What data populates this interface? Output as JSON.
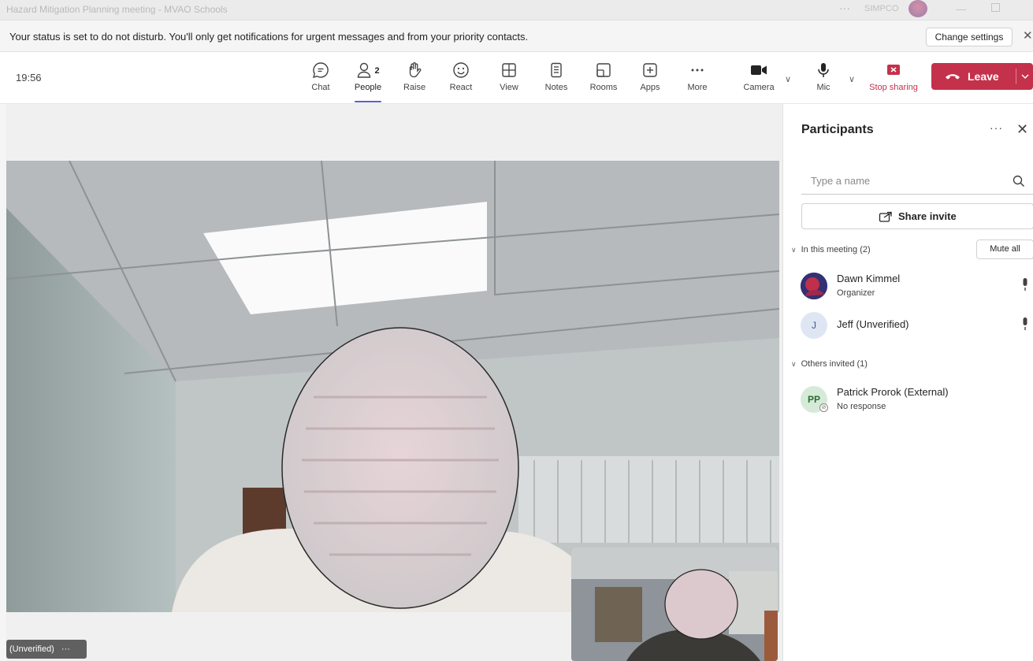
{
  "window": {
    "title": "Hazard Mitigation Planning meeting - MVAO Schools",
    "more": "···",
    "org": "SIMPCO"
  },
  "notification": {
    "message": "Your status is set to do not disturb. You'll only get notifications for urgent messages and from your priority contacts.",
    "change_settings": "Change settings"
  },
  "toolbar": {
    "time": "19:56",
    "people_count": "2",
    "buttons": [
      {
        "label": "Chat",
        "icon": "chat-icon"
      },
      {
        "label": "People",
        "icon": "people-icon"
      },
      {
        "label": "Raise",
        "icon": "hand-icon"
      },
      {
        "label": "React",
        "icon": "smiley-icon"
      },
      {
        "label": "View",
        "icon": "grid-icon"
      },
      {
        "label": "Notes",
        "icon": "notes-icon"
      },
      {
        "label": "Rooms",
        "icon": "rooms-icon"
      },
      {
        "label": "Apps",
        "icon": "apps-icon"
      },
      {
        "label": "More",
        "icon": "more-icon"
      },
      {
        "label": "Camera",
        "icon": "camera-icon"
      },
      {
        "label": "Mic",
        "icon": "mic-icon"
      },
      {
        "label": "Stop sharing",
        "icon": "stop-share-icon"
      }
    ],
    "leave": "Leave",
    "accent": "#5b5fc7",
    "leave_color": "#c4314b"
  },
  "stage": {
    "name_tag": "(Unverified)",
    "name_tag_more": "···"
  },
  "participants": {
    "title": "Participants",
    "search_placeholder": "Type a name",
    "share_invite": "Share invite",
    "in_meeting_label": "In this meeting (2)",
    "mute_all": "Mute all",
    "in_meeting": [
      {
        "name": "Dawn Kimmel",
        "role": "Organizer",
        "initials": ""
      },
      {
        "name": "Jeff (Unverified)",
        "role": "",
        "initials": "J"
      }
    ],
    "others_label": "Others invited (1)",
    "others": [
      {
        "name": "Patrick Prorok (External)",
        "status": "No response",
        "initials": "PP"
      }
    ]
  }
}
